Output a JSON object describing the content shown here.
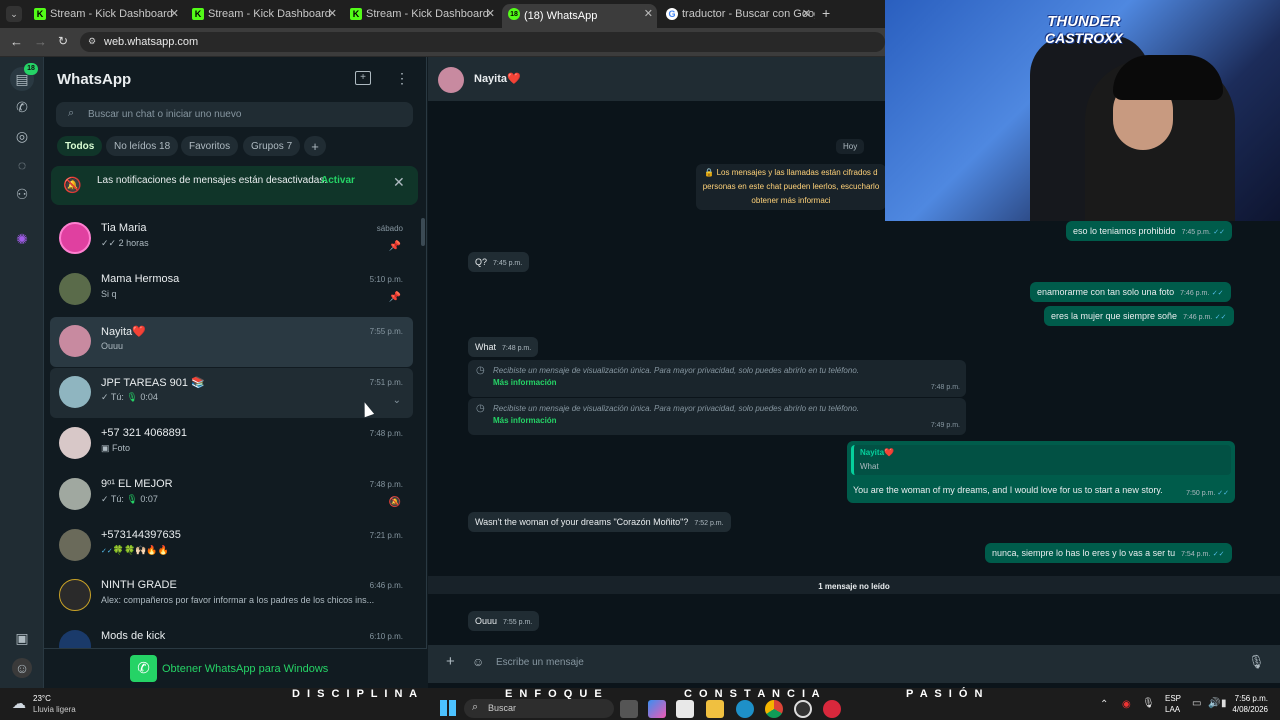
{
  "browser": {
    "tabs": [
      {
        "title": "Stream - Kick Dashboard"
      },
      {
        "title": "Stream - Kick Dashboard"
      },
      {
        "title": "Stream - Kick Dashboard"
      },
      {
        "title": "(18) WhatsApp",
        "badge": "18"
      },
      {
        "title": "traductor - Buscar con Google"
      }
    ],
    "url": "web.whatsapp.com"
  },
  "rail": {
    "chats_badge": "18"
  },
  "sidebar": {
    "title": "WhatsApp",
    "search_placeholder": "Buscar un chat o iniciar uno nuevo",
    "filters": [
      {
        "label": "Todos"
      },
      {
        "label": "No leídos",
        "count": "18"
      },
      {
        "label": "Favoritos"
      },
      {
        "label": "Grupos",
        "count": "7"
      }
    ],
    "notice": {
      "text": "Las notificaciones de mensajes están desactivadas.",
      "action": "Activar"
    },
    "chats": [
      {
        "name": "Tia Maria",
        "time": "sábado",
        "preview": "2 horas",
        "color": "#e040a0"
      },
      {
        "name": "Mama Hermosa",
        "time": "5:10 p.m.",
        "preview": "Si q",
        "color": "#5a6b4a"
      },
      {
        "name": "Nayita❤️",
        "time": "7:55 p.m.",
        "preview": "Ouuu",
        "color": "#c88aa0"
      },
      {
        "name": "JPF TAREAS 901 📚",
        "time": "7:51 p.m.",
        "preview_prefix": "Tú:",
        "preview": "0:04",
        "color": "#8fb5c0"
      },
      {
        "name": "+57 321 4068891",
        "time": "7:48 p.m.",
        "preview": "Foto",
        "color": "#d8c8c8"
      },
      {
        "name": "9ᵒ¹ EL MEJOR",
        "time": "7:48 p.m.",
        "preview_prefix": "Tú:",
        "preview": "0:07",
        "color": "#a0a8a0"
      },
      {
        "name": "+573144397635",
        "time": "7:21 p.m.",
        "preview": "🍀🍀🙌🏻🔥🔥",
        "color": "#6a6a5a"
      },
      {
        "name": "NINTH GRADE",
        "time": "6:46 p.m.",
        "preview": "Alex: compañeros por favor informar a los padres de los chicos ins...",
        "color": "#2a2a2a"
      },
      {
        "name": "Mods de kick",
        "time": "6:10 p.m.",
        "preview": "",
        "color": "#1a3a6a"
      }
    ],
    "footer_link": "Obtener WhatsApp para Windows"
  },
  "chat": {
    "contact": "Nayita❤️",
    "date_label": "Hoy",
    "encryption_notice": [
      "🔒 Los mensajes y las llamadas están cifrados d",
      "personas en este chat pueden leerlos, escucharlo",
      "obtener más informaci"
    ],
    "messages": [
      {
        "dir": "out",
        "text": "eso lo teniamos prohibido",
        "time": "7:45 p.m."
      },
      {
        "dir": "in",
        "text": "Q?",
        "time": "7:45 p.m."
      },
      {
        "dir": "out",
        "text": "enamorarme con tan solo una foto",
        "time": "7:46 p.m."
      },
      {
        "dir": "out",
        "text": "eres la mujer que siempre soñe",
        "time": "7:46 p.m."
      },
      {
        "dir": "in",
        "text": "What",
        "time": "7:48 p.m."
      },
      {
        "dir": "in",
        "text": "Recibiste un mensaje de visualización única. Para mayor privacidad, solo puedes abrirlo en tu teléfono.",
        "link": "Más información",
        "time": "7:48 p.m."
      },
      {
        "dir": "in",
        "text": "Recibiste un mensaje de visualización única. Para mayor privacidad, solo puedes abrirlo en tu teléfono.",
        "link": "Más información",
        "time": "7:49 p.m."
      },
      {
        "dir": "out",
        "quote_author": "Nayita❤️",
        "quote_text": "What",
        "text": "You are the woman of my dreams, and I would love for us to start a new story.",
        "time": "7:50 p.m."
      },
      {
        "dir": "in",
        "text": "Wasn't the woman of your dreams \"Corazón Moñito\"?",
        "time": "7:52 p.m."
      },
      {
        "dir": "out",
        "text": "nunca, siempre lo has lo eres y lo vas a ser tu",
        "time": "7:54 p.m."
      },
      {
        "dir": "in",
        "text": "Ouuu",
        "time": "7:55 p.m."
      }
    ],
    "unread_label": "1 mensaje no leído",
    "composer_placeholder": "Escribe un mensaje"
  },
  "overlay": {
    "logo_line1": "THUNDER",
    "logo_line2": "CASTROXX",
    "words": [
      "D I S C I P L I N A",
      "E N F O Q U E",
      "C O N S T A N C I A",
      "P A S I Ó N"
    ]
  },
  "taskbar": {
    "weather_temp": "23°C",
    "weather_desc": "Lluvia ligera",
    "search_label": "Buscar",
    "lang": "ESP",
    "lang_sub": "LAA",
    "time": "7:56 p.m.",
    "date": "4/08/2026"
  }
}
